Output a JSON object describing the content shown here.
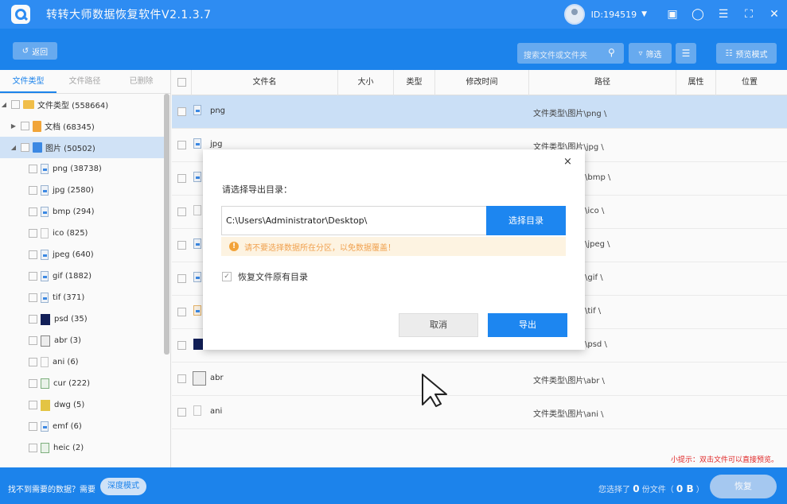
{
  "titlebar": {
    "app_title": "转转大师数据恢复软件V2.1.3.7",
    "user_id": "ID:194519",
    "caret": "▼",
    "icons": [
      "screen-icon",
      "shirt-icon",
      "menu-icon",
      "fullscreen-icon",
      "close-icon"
    ]
  },
  "toolbar": {
    "back_label": "返回",
    "search_placeholder": "搜索文件或文件夹",
    "filter_label": "筛选",
    "preview_mode_label": "预览模式"
  },
  "left_tabs": [
    "文件类型",
    "文件路径",
    "已删除"
  ],
  "tree": {
    "root": "文件类型 (558664)",
    "docs": "文档 (68345)",
    "images": "图片 (50502)",
    "children": [
      "png (38738)",
      "jpg (2580)",
      "bmp (294)",
      "ico (825)",
      "jpeg (640)",
      "gif (1882)",
      "tif (371)",
      "psd (35)",
      "abr (3)",
      "ani (6)",
      "cur (222)",
      "dwg (5)",
      "emf (6)",
      "heic (2)"
    ]
  },
  "list_header": {
    "name": "文件名",
    "size": "大小",
    "type": "类型",
    "modified": "修改时间",
    "path": "路径",
    "attr": "属性",
    "location": "位置"
  },
  "rows": [
    {
      "name": "png",
      "path": "文件类型\\图片\\png \\"
    },
    {
      "name": "jpg",
      "path": "文件类型\\图片\\jpg \\"
    },
    {
      "name": "",
      "path": "\\bmp \\"
    },
    {
      "name": "",
      "path": "\\ico \\"
    },
    {
      "name": "",
      "path": "\\jpeg \\"
    },
    {
      "name": "",
      "path": "\\gif \\"
    },
    {
      "name": "",
      "path": "\\tif \\"
    },
    {
      "name": "",
      "path": "\\psd \\"
    },
    {
      "name": "abr",
      "path": "文件类型\\图片\\abr \\"
    },
    {
      "name": "ani",
      "path": "文件类型\\图片\\ani \\"
    }
  ],
  "tip": "小提示：双击文件可以直接预览。",
  "status": {
    "not_found": "找不到需要的数据？需要",
    "deep_mode": "深度模式",
    "selected_prefix": "您选择了",
    "selected_count": "0",
    "selected_mid": "份文件（",
    "selected_size": "0 B",
    "selected_suffix": "）",
    "recover": "恢复"
  },
  "modal": {
    "label": "请选择导出目录：",
    "path_value": "C:\\Users\\Administrator\\Desktop\\",
    "choose_dir": "选择目录",
    "warning": "请不要选择数据所在分区，以免数据覆盖！",
    "keep_structure": "恢复文件原有目录",
    "keep_checked": true,
    "cancel": "取消",
    "export": "导出",
    "close": "×"
  },
  "colors": {
    "primary": "#1d86f0",
    "selected_row": "#cfe4fb",
    "warning_text": "#f0a14f",
    "tip_red": "#e52929"
  }
}
